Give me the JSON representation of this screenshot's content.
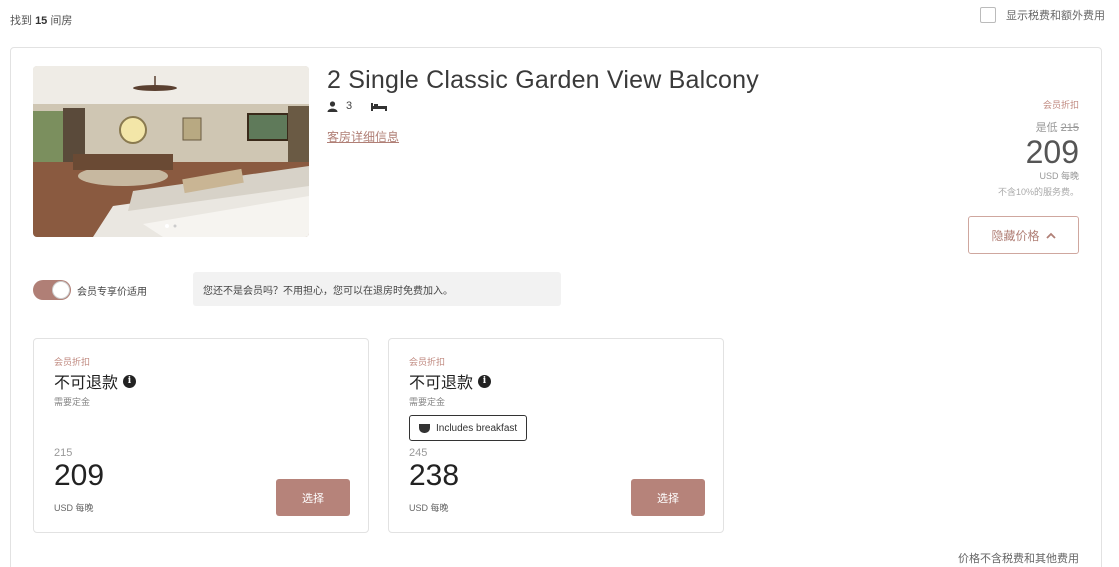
{
  "header": {
    "results_prefix": "找到",
    "results_count": "15",
    "results_suffix": "间房",
    "tax_toggle_label": "显示税费和额外费用"
  },
  "room": {
    "title": "2 Single Classic Garden View Balcony",
    "guests": "3",
    "details_link": "客房详细信息",
    "member_discount": "会员折扣",
    "original_price_prefix": "是低",
    "original_price": "215",
    "price": "209",
    "per_night": "USD 每晚",
    "tax_note": "不含10%的服务费。",
    "hide_price_button": "隐藏价格"
  },
  "member_rate": {
    "toggle_label": "会员专享价适用",
    "tip": "您还不是会员吗？不用担心，您可以在退房时免费加入。"
  },
  "rates": [
    {
      "discount": "会员折扣",
      "policy": "不可退款",
      "prepay": "需要定金",
      "badge": "",
      "original_price": "215",
      "price": "209",
      "unit": "USD 每晚",
      "select_label": "选择"
    },
    {
      "discount": "会员折扣",
      "policy": "不可退款",
      "prepay": "需要定金",
      "badge": "Includes breakfast",
      "original_price": "245",
      "price": "238",
      "unit": "USD 每晚",
      "select_label": "选择"
    }
  ],
  "footer": {
    "note": "价格不含税费和其他费用"
  },
  "colors": {
    "accent": "#b07f76",
    "button": "#b6837a"
  }
}
